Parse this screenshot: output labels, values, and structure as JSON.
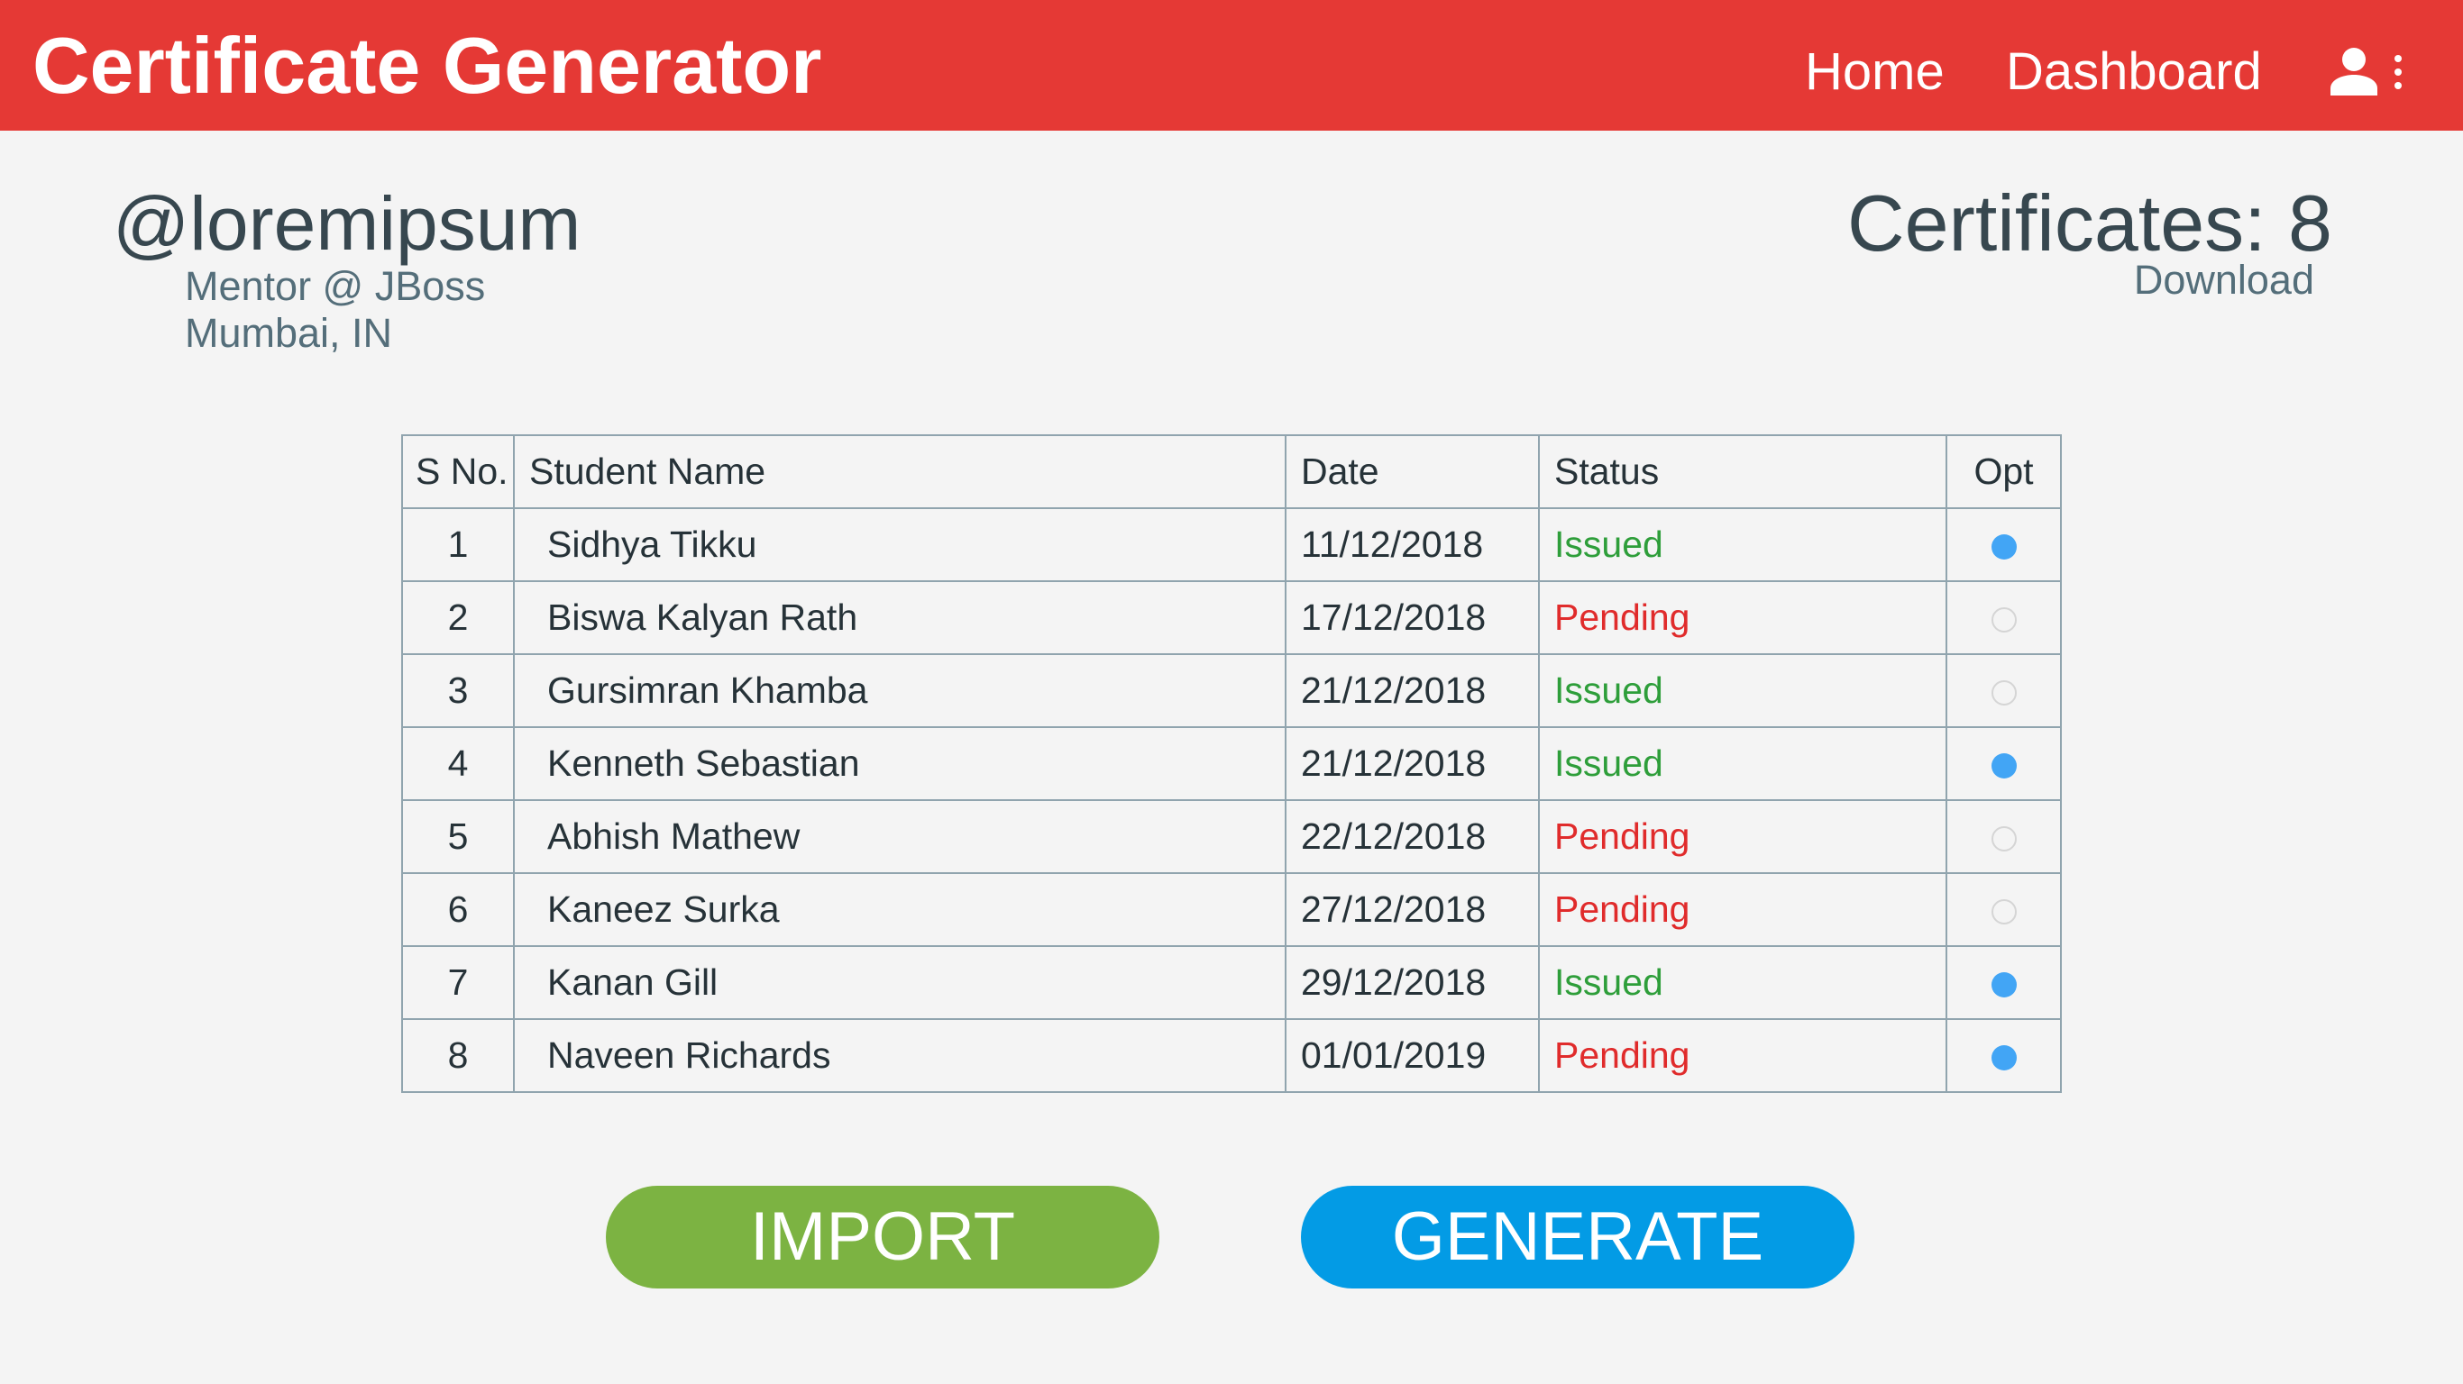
{
  "app": {
    "title": "Certificate Generator",
    "accent_color": "#e53935"
  },
  "nav": {
    "home": "Home",
    "dashboard": "Dashboard",
    "user_icon": "account-icon",
    "menu_icon": "more-vert-icon"
  },
  "profile": {
    "username": "@loremipsum",
    "role": "Mentor @ JBoss",
    "location": "Mumbai, IN"
  },
  "summary": {
    "certificates_label": "Certificates: 8",
    "download_label": "Download"
  },
  "table": {
    "headers": [
      "S No.",
      "Student Name",
      "Date",
      "Status",
      "Opt"
    ],
    "rows": [
      {
        "sno": "1",
        "name": "Sidhya Tikku",
        "date": "11/12/2018",
        "status": "Issued",
        "selected": true
      },
      {
        "sno": "2",
        "name": "Biswa Kalyan Rath",
        "date": "17/12/2018",
        "status": "Pending",
        "selected": false
      },
      {
        "sno": "3",
        "name": "Gursimran Khamba",
        "date": "21/12/2018",
        "status": "Issued",
        "selected": false
      },
      {
        "sno": "4",
        "name": "Kenneth Sebastian",
        "date": "21/12/2018",
        "status": "Issued",
        "selected": true
      },
      {
        "sno": "5",
        "name": "Abhish Mathew",
        "date": "22/12/2018",
        "status": "Pending",
        "selected": false
      },
      {
        "sno": "6",
        "name": "Kaneez Surka",
        "date": "27/12/2018",
        "status": "Pending",
        "selected": false
      },
      {
        "sno": "7",
        "name": "Kanan Gill",
        "date": "29/12/2018",
        "status": "Issued",
        "selected": true
      },
      {
        "sno": "8",
        "name": "Naveen Richards",
        "date": "01/01/2019",
        "status": "Pending",
        "selected": true
      }
    ]
  },
  "status_colors": {
    "Issued": "#2e9e3a",
    "Pending": "#e02b2b"
  },
  "actions": {
    "import_label": "IMPORT",
    "import_color": "#7cb342",
    "generate_label": "GENERATE",
    "generate_color": "#039be5"
  }
}
